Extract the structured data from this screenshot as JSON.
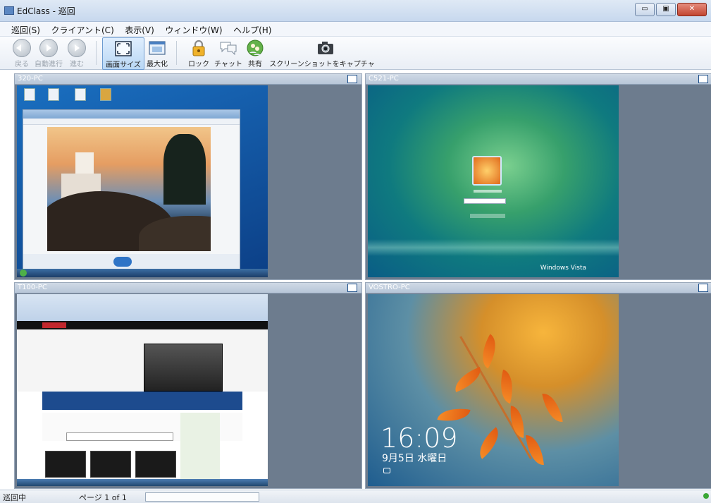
{
  "window": {
    "title": "EdClass - 巡回",
    "minimize": "▭",
    "maximize": "▣",
    "close": "✕"
  },
  "menu": [
    "巡回(S)",
    "クライアント(C)",
    "表示(V)",
    "ウィンドウ(W)",
    "ヘルプ(H)"
  ],
  "toolbar": {
    "back": "戻る",
    "auto": "自動進行",
    "forward": "進む",
    "fit": "画面サイズ",
    "maximize": "最大化",
    "lock": "ロック",
    "chat": "チャット",
    "share": "共有",
    "screenshot": "スクリーンショットをキャプチャ"
  },
  "panels": [
    {
      "name": "320-PC"
    },
    {
      "name": "C521-PC"
    },
    {
      "name": "T100-PC"
    },
    {
      "name": "VOSTRO-PC"
    }
  ],
  "screens": {
    "vista_brand": "Windows Vista",
    "lock_time": "16:09",
    "lock_date": "9月5日 水曜日"
  },
  "status": {
    "state": "巡回中",
    "page": "ページ 1 of 1"
  },
  "colors": {
    "panel_bg": "#6d7c8e",
    "accent": "#3a7bd5",
    "close": "#c24530"
  }
}
